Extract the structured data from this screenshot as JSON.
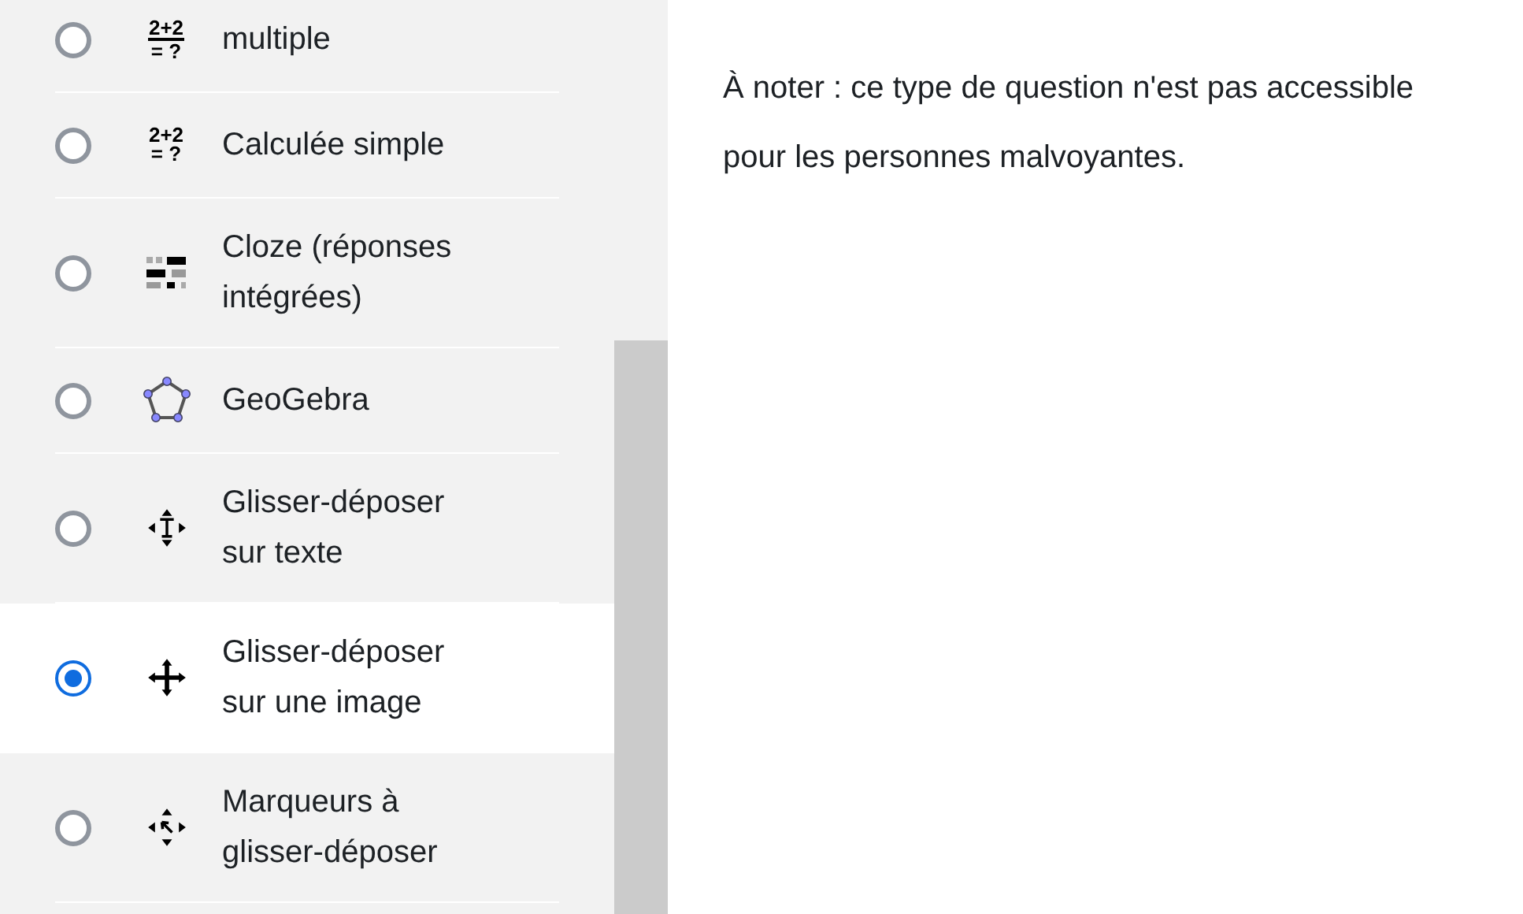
{
  "question_types": [
    {
      "label": "multiple",
      "selected": false,
      "icon": {
        "kind": "fraction",
        "top": "2+2",
        "bottom": "= ?"
      }
    },
    {
      "label": "Calculée simple",
      "selected": false,
      "icon": {
        "kind": "calc",
        "top": "2+2",
        "bottom": "= ?"
      }
    },
    {
      "label": "Cloze (réponses intégrées)",
      "selected": false,
      "icon": {
        "kind": "cloze"
      }
    },
    {
      "label": "GeoGebra",
      "selected": false,
      "icon": {
        "kind": "polygon"
      }
    },
    {
      "label": "Glisser-déposer sur texte",
      "selected": false,
      "icon": {
        "kind": "move-text"
      }
    },
    {
      "label": "Glisser-déposer sur une image",
      "selected": true,
      "icon": {
        "kind": "move"
      }
    },
    {
      "label": "Marqueurs à glisser-déposer",
      "selected": false,
      "icon": {
        "kind": "markers"
      }
    }
  ],
  "description": "À noter : ce type de question n'est pas accessible pour les personnes malvoyantes."
}
